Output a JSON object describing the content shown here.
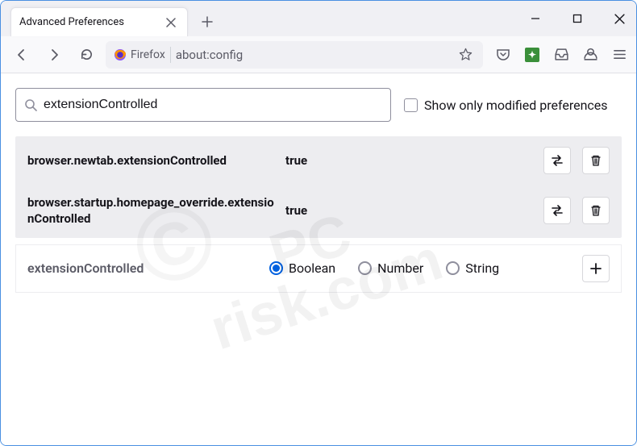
{
  "window": {
    "tab_title": "Advanced Preferences"
  },
  "addressbar": {
    "brand": "Firefox",
    "url": "about:config"
  },
  "search": {
    "value": "extensionControlled",
    "modified_only_label": "Show only modified preferences"
  },
  "prefs": [
    {
      "name": "browser.newtab.extensionControlled",
      "value": "true"
    },
    {
      "name": "browser.startup.homepage_override.extensionControlled",
      "value": "true"
    }
  ],
  "add": {
    "name": "extensionControlled",
    "options": [
      "Boolean",
      "Number",
      "String"
    ],
    "selected": "Boolean"
  },
  "watermark": {
    "line1": "PC",
    "line2": "risk.com"
  }
}
